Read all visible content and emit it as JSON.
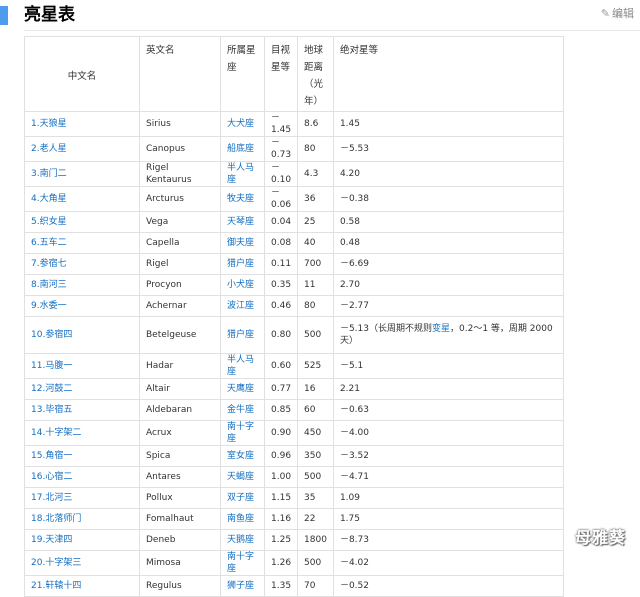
{
  "page": {
    "title": "亮星表",
    "edit_label": "编辑"
  },
  "table": {
    "headers": [
      "中文名",
      "英文名",
      "所属星座",
      "目视星等",
      "地球距离（光年）",
      "绝对星等"
    ],
    "rows": [
      {
        "cn": "1.天狼星",
        "en": "Sirius",
        "const": "大犬座",
        "app": "－1.45",
        "dist": "8.6",
        "abs": "1.45"
      },
      {
        "cn": "2.老人星",
        "en": "Canopus",
        "const": "船底座",
        "app": "－0.73",
        "dist": "80",
        "abs": "－5.53"
      },
      {
        "cn": "3.南门二",
        "en": "Rigel Kentaurus",
        "const": "半人马座",
        "app": "－0.10",
        "dist": "4.3",
        "abs": "4.20"
      },
      {
        "cn": "4.大角星",
        "en": "Arcturus",
        "const": "牧夫座",
        "app": "－0.06",
        "dist": "36",
        "abs": "－0.38"
      },
      {
        "cn": "5.织女星",
        "en": "Vega",
        "const": "天琴座",
        "app": "0.04",
        "dist": "25",
        "abs": "0.58"
      },
      {
        "cn": "6.五车二",
        "en": "Capella",
        "const": "御夫座",
        "app": "0.08",
        "dist": "40",
        "abs": "0.48"
      },
      {
        "cn": "7.参宿七",
        "en": "Rigel",
        "const": "猎户座",
        "app": "0.11",
        "dist": "700",
        "abs": "－6.69"
      },
      {
        "cn": "8.南河三",
        "en": "Procyon",
        "const": "小犬座",
        "app": "0.35",
        "dist": "11",
        "abs": "2.70"
      },
      {
        "cn": "9.水委一",
        "en": "Achernar",
        "const": "波江座",
        "app": "0.46",
        "dist": "80",
        "abs": "－2.77"
      },
      {
        "cn": "10.参宿四",
        "en": "Betelgeuse",
        "const": "猎户座",
        "app": "0.80",
        "dist": "500",
        "abs_pre": "－5.13（长周期不规则",
        "abs_link": "变星",
        "abs_post": "，0.2～1 等，周期 2000 天）"
      },
      {
        "cn": "11.马腹一",
        "en": "Hadar",
        "const": "半人马座",
        "app": "0.60",
        "dist": "525",
        "abs": "－5.1"
      },
      {
        "cn": "12.河鼓二",
        "en": "Altair",
        "const": "天鹰座",
        "app": "0.77",
        "dist": "16",
        "abs": "2.21"
      },
      {
        "cn": "13.毕宿五",
        "en": "Aldebaran",
        "const": "金牛座",
        "app": "0.85",
        "dist": "60",
        "abs": "－0.63"
      },
      {
        "cn": "14.十字架二",
        "en": "Acrux",
        "const": "南十字座",
        "app": "0.90",
        "dist": "450",
        "abs": "－4.00"
      },
      {
        "cn": "15.角宿一",
        "en": "Spica",
        "const": "室女座",
        "app": "0.96",
        "dist": "350",
        "abs": "－3.52"
      },
      {
        "cn": "16.心宿二",
        "en": "Antares",
        "const": "天蝎座",
        "app": "1.00",
        "dist": "500",
        "abs": "－4.71"
      },
      {
        "cn": "17.北河三",
        "en": "Pollux",
        "const": "双子座",
        "app": "1.15",
        "dist": "35",
        "abs": "1.09"
      },
      {
        "cn": "18.北落师门",
        "en": "Fomalhaut",
        "const": "南鱼座",
        "app": "1.16",
        "dist": "22",
        "abs": "1.75"
      },
      {
        "cn": "19.天津四",
        "en": "Deneb",
        "const": "天鹅座",
        "app": "1.25",
        "dist": "1800",
        "abs": "－8.73"
      },
      {
        "cn": "20.十字架三",
        "en": "Mimosa",
        "const": "南十字座",
        "app": "1.26",
        "dist": "500",
        "abs": "－4.02"
      },
      {
        "cn": "21.轩辕十四",
        "en": "Regulus",
        "const": "狮子座",
        "app": "1.35",
        "dist": "70",
        "abs": "－0.52"
      }
    ]
  },
  "watermark": "母雅葵"
}
